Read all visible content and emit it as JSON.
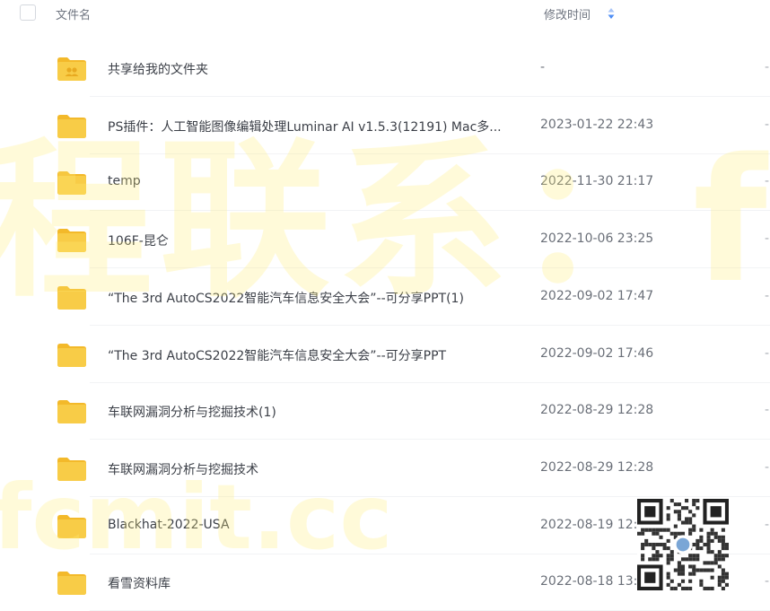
{
  "header": {
    "name_col": "文件名",
    "time_col": "修改时间"
  },
  "files": [
    {
      "name": "共享给我的文件夹",
      "time": "-",
      "type": "shared",
      "dash": "-"
    },
    {
      "name": "PS插件：人工智能图像编辑处理Luminar AI v1.5.3(12191) Mac多...",
      "time": "2023-01-22 22:43",
      "type": "folder",
      "dash": "-"
    },
    {
      "name": "temp",
      "time": "2022-11-30 21:17",
      "type": "folder",
      "dash": "-"
    },
    {
      "name": "106F-昆仑",
      "time": "2022-10-06 23:25",
      "type": "folder",
      "dash": "-"
    },
    {
      "name": "“The 3rd AutoCS2022智能汽车信息安全大会”--可分享PPT(1)",
      "time": "2022-09-02 17:47",
      "type": "folder",
      "dash": "-"
    },
    {
      "name": "“The 3rd AutoCS2022智能汽车信息安全大会”--可分享PPT",
      "time": "2022-09-02 17:46",
      "type": "folder",
      "dash": "-"
    },
    {
      "name": "车联网漏洞分析与挖掘技术(1)",
      "time": "2022-08-29 12:28",
      "type": "folder",
      "dash": "-"
    },
    {
      "name": "车联网漏洞分析与挖掘技术",
      "time": "2022-08-29 12:28",
      "type": "folder",
      "dash": "-"
    },
    {
      "name": "Blackhat-2022-USA",
      "time": "2022-08-19 12:43",
      "type": "folder",
      "dash": "-"
    },
    {
      "name": "看雪资料库",
      "time": "2022-08-18 13:11",
      "type": "folder",
      "dash": "-"
    }
  ],
  "watermark": {
    "line1": "程联系：fc",
    "line2": "fcmit.cc"
  },
  "colors": {
    "folder_yellow": "#f8cc47",
    "folder_tab": "#f3b92a",
    "sort_blue": "#4d8df5"
  },
  "icons": {
    "sort": "sort-icon",
    "folder": "folder-icon",
    "shared_folder": "shared-folder-icon",
    "qr": "qr-code-icon"
  }
}
